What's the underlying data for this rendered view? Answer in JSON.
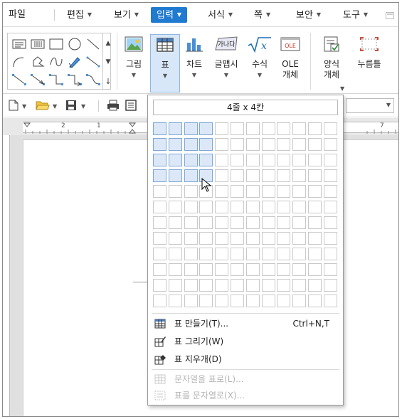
{
  "menu": {
    "items": [
      {
        "label": "파일"
      },
      {
        "label": "편집"
      },
      {
        "label": "보기"
      },
      {
        "label": "입력"
      },
      {
        "label": "서식"
      },
      {
        "label": "쪽"
      },
      {
        "label": "보안"
      },
      {
        "label": "도구"
      }
    ],
    "active": "입력"
  },
  "ribbon": {
    "picture": "그림",
    "table": "표",
    "chart": "차트",
    "wordart": "글맵시",
    "formula": "수식",
    "ole": "OLE\n개체",
    "form_object": "양식\n개체",
    "push_button": "누름틀",
    "wordart_icon_text": "가나다",
    "ole_icon_text": "OLE"
  },
  "table_dropdown": {
    "size_label": "4줄 x 4칸",
    "grid_rows": 12,
    "grid_cols": 12,
    "selected_rows": 4,
    "selected_cols": 4,
    "items": [
      {
        "label": "표 만들기(T)...",
        "shortcut": "Ctrl+N,T",
        "icon": "table-grid-icon",
        "enabled": true
      },
      {
        "label": "표 그리기(W)",
        "shortcut": "",
        "icon": "draw-table-icon",
        "enabled": true
      },
      {
        "label": "표 지우개(D)",
        "shortcut": "",
        "icon": "table-eraser-icon",
        "enabled": true
      },
      {
        "label": "문자열을 표로(L)...",
        "shortcut": "",
        "icon": "text-to-table-icon",
        "enabled": false
      },
      {
        "label": "표를 문자열로(X)...",
        "shortcut": "",
        "icon": "table-to-text-icon",
        "enabled": false
      }
    ]
  },
  "ruler": {
    "labels": [
      "2",
      "1",
      "7"
    ]
  },
  "colors": {
    "accent": "#1f7ad0",
    "selection": "#dce8f8",
    "ribbon_highlight": "#d7e7f7"
  }
}
